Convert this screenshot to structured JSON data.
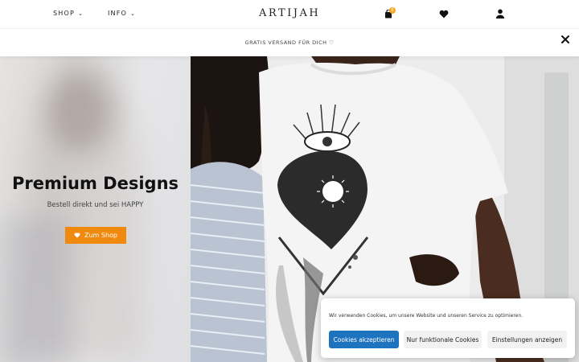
{
  "header": {
    "nav": [
      {
        "label": "SHOP"
      },
      {
        "label": "INFO"
      }
    ],
    "logo": "ARTIJAH",
    "cart_count": "0"
  },
  "announcement": {
    "text": "GRATIS VERSAND FÜR DICH ♡"
  },
  "hero": {
    "title": "Premium Designs",
    "subtitle": "Bestell direkt und sei HAPPY",
    "button_label": "Zum Shop"
  },
  "cookie_banner": {
    "text": "Wir verwenden Cookies, um unsere Website und unseren Service zu optimieren.",
    "accept_label": "Cookies akzeptieren",
    "functional_label": "Nur funktionale Cookies",
    "settings_label": "Einstellungen anzeigen"
  },
  "colors": {
    "accent": "#f08a0f",
    "cookie_accept": "#1e73be",
    "badge": "#f5a623"
  }
}
